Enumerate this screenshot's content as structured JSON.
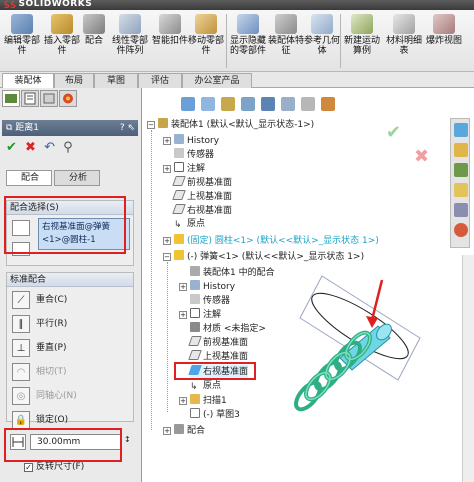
{
  "app": {
    "name": "SOLIDWORKS"
  },
  "toolbar": {
    "buttons": [
      {
        "label": "编辑零部件",
        "icon": "edit-component-icon"
      },
      {
        "label": "插入零部件",
        "icon": "insert-component-icon"
      },
      {
        "label": "配合",
        "icon": "mate-icon"
      },
      {
        "label": "线性零部件阵列",
        "icon": "linear-pattern-icon"
      },
      {
        "label": "智能扣件",
        "icon": "smart-fastener-icon"
      },
      {
        "label": "移动零部件",
        "icon": "move-component-icon"
      },
      {
        "label": "显示隐藏的零部件",
        "icon": "show-hidden-icon"
      },
      {
        "label": "装配体特征",
        "icon": "assembly-feature-icon"
      },
      {
        "label": "参考几何体",
        "icon": "reference-geometry-icon"
      },
      {
        "label": "新建运动算例",
        "icon": "new-motion-study-icon"
      },
      {
        "label": "材料明细表",
        "icon": "bom-icon"
      },
      {
        "label": "爆炸视图",
        "icon": "exploded-view-icon"
      }
    ]
  },
  "tabs": [
    "装配体",
    "布局",
    "草图",
    "评估",
    "办公室产品"
  ],
  "panel": {
    "title": "距离1",
    "title_icons": "? ⇖",
    "subtabs": [
      "配合",
      "分析"
    ],
    "mate_selection": {
      "header": "配合选择(S)",
      "selection_text": "右视基准面@弹簧<1>@圆柱-1"
    },
    "standard_mates": {
      "header": "标准配合",
      "items": [
        {
          "label": "重合(C)",
          "icon": "coincident-icon",
          "enabled": true
        },
        {
          "label": "平行(R)",
          "icon": "parallel-icon",
          "enabled": true
        },
        {
          "label": "垂直(P)",
          "icon": "perpendicular-icon",
          "enabled": true
        },
        {
          "label": "相切(T)",
          "icon": "tangent-icon",
          "enabled": false
        },
        {
          "label": "同轴心(N)",
          "icon": "concentric-icon",
          "enabled": false
        },
        {
          "label": "锁定(O)",
          "icon": "lock-icon",
          "enabled": true
        }
      ]
    },
    "distance_value": "30.00mm",
    "flip_dimension": "反转尺寸(F)"
  },
  "tree": {
    "root": "装配体1 (默认<默认_显示状态-1>)",
    "items": [
      {
        "label": "History",
        "indent": 1
      },
      {
        "label": "传感器",
        "indent": 1
      },
      {
        "label": "注解",
        "indent": 1
      },
      {
        "label": "前视基准面",
        "indent": 1
      },
      {
        "label": "上视基准面",
        "indent": 1
      },
      {
        "label": "右视基准面",
        "indent": 1
      },
      {
        "label": "原点",
        "indent": 1
      },
      {
        "label": "(固定) 圆柱<1> (默认<<默认>_显示状态 1>)",
        "indent": 1,
        "highlight": "cyan"
      },
      {
        "label": "(-) 弹簧<1> (默认<<默认>_显示状态 1>)",
        "indent": 1
      },
      {
        "label": "装配体1 中的配合",
        "indent": 2
      },
      {
        "label": "History",
        "indent": 2
      },
      {
        "label": "传感器",
        "indent": 2
      },
      {
        "label": "注解",
        "indent": 2
      },
      {
        "label": "材质 <未指定>",
        "indent": 2
      },
      {
        "label": "前视基准面",
        "indent": 2
      },
      {
        "label": "上视基准面",
        "indent": 2
      },
      {
        "label": "右视基准面",
        "indent": 2,
        "boxed": true
      },
      {
        "label": "原点",
        "indent": 2
      },
      {
        "label": "扫描1",
        "indent": 2
      },
      {
        "label": "(-) 草图3",
        "indent": 2
      },
      {
        "label": "配合",
        "indent": 1
      }
    ]
  },
  "colors": {
    "highlight_red": "#e02020",
    "selection_blue": "#c9ddf4",
    "tree_cyan": "#1aa3c8",
    "spring_green": "#3ec3a0"
  }
}
